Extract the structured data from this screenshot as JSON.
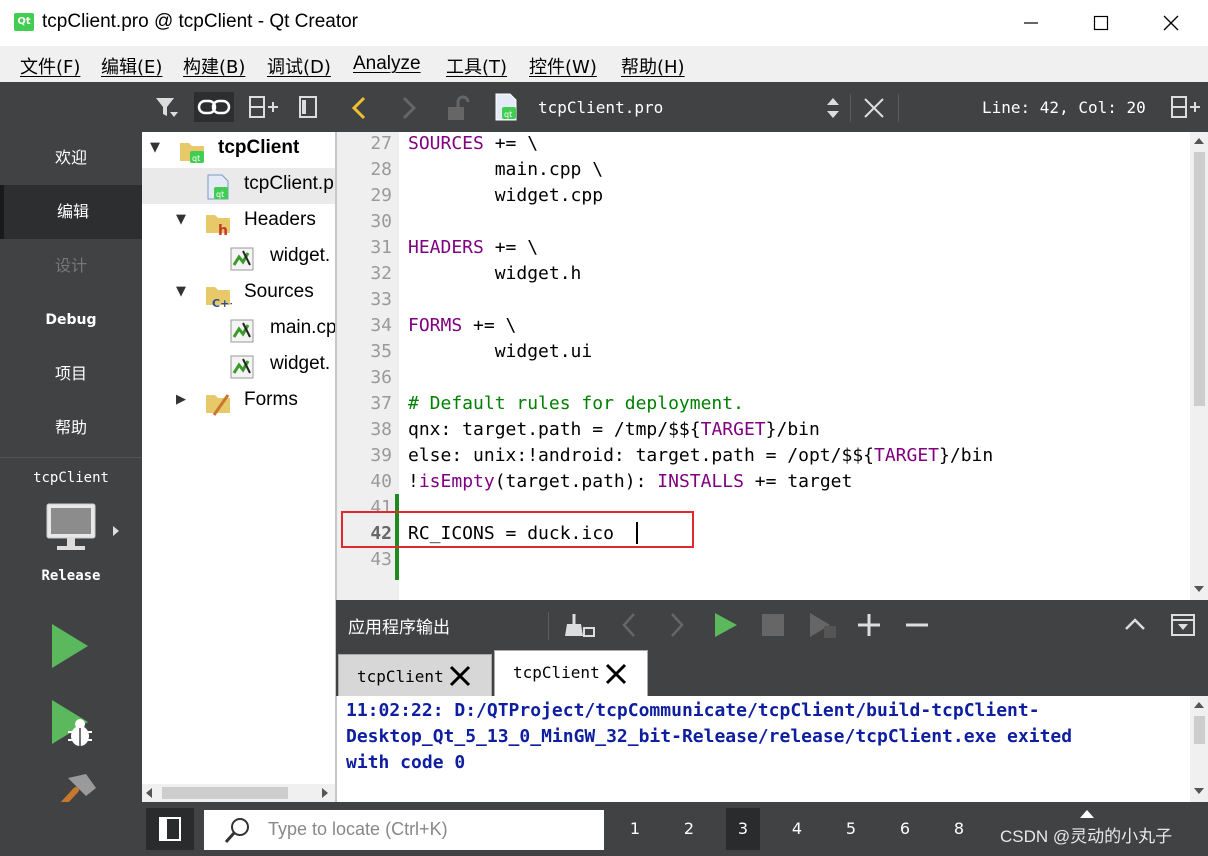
{
  "window": {
    "app_logo": "Qt",
    "title": "tcpClient.pro @ tcpClient - Qt Creator"
  },
  "menu": [
    "文件(F)",
    "编辑(E)",
    "构建(B)",
    "调试(D)",
    "Analyze",
    "工具(T)",
    "控件(W)",
    "帮助(H)"
  ],
  "modes": [
    "欢迎",
    "编辑",
    "设计",
    "Debug",
    "项目",
    "帮助"
  ],
  "target": {
    "project": "tcpClient",
    "config": "Release"
  },
  "tree": {
    "root": "tcpClient",
    "pro_file": "tcpClient.p",
    "headers": "Headers",
    "header_file": "widget.",
    "sources": "Sources",
    "source_main": "main.cp",
    "source_widget": "widget.",
    "forms": "Forms"
  },
  "editor": {
    "file_icon": "qt",
    "file_name": "tcpClient.pro",
    "cursor": "Line: 42, Col: 20",
    "lines": [
      {
        "n": "27",
        "segs": [
          {
            "t": "SOURCES",
            "c": "kw"
          },
          {
            "t": " += \\",
            "c": ""
          }
        ]
      },
      {
        "n": "28",
        "segs": [
          {
            "t": "        main.cpp \\",
            "c": ""
          }
        ]
      },
      {
        "n": "29",
        "segs": [
          {
            "t": "        widget.cpp",
            "c": ""
          }
        ]
      },
      {
        "n": "30",
        "segs": []
      },
      {
        "n": "31",
        "segs": [
          {
            "t": "HEADERS",
            "c": "kw"
          },
          {
            "t": " += \\",
            "c": ""
          }
        ]
      },
      {
        "n": "32",
        "segs": [
          {
            "t": "        widget.h",
            "c": ""
          }
        ]
      },
      {
        "n": "33",
        "segs": []
      },
      {
        "n": "34",
        "segs": [
          {
            "t": "FORMS",
            "c": "kw"
          },
          {
            "t": " += \\",
            "c": ""
          }
        ]
      },
      {
        "n": "35",
        "segs": [
          {
            "t": "        widget.ui",
            "c": ""
          }
        ]
      },
      {
        "n": "36",
        "segs": []
      },
      {
        "n": "37",
        "segs": [
          {
            "t": "# Default rules for deployment.",
            "c": "cm"
          }
        ]
      },
      {
        "n": "38",
        "segs": [
          {
            "t": "qnx: target.path = /tmp/$${",
            "c": ""
          },
          {
            "t": "TARGET",
            "c": "kw"
          },
          {
            "t": "}/bin",
            "c": ""
          }
        ]
      },
      {
        "n": "39",
        "segs": [
          {
            "t": "else: unix:!android: target.path = /opt/$${",
            "c": ""
          },
          {
            "t": "TARGET",
            "c": "kw"
          },
          {
            "t": "}/bin",
            "c": ""
          }
        ]
      },
      {
        "n": "40",
        "segs": [
          {
            "t": "!",
            "c": ""
          },
          {
            "t": "isEmpty",
            "c": "kw"
          },
          {
            "t": "(target.path): ",
            "c": ""
          },
          {
            "t": "INSTALLS",
            "c": "kw"
          },
          {
            "t": " += target",
            "c": ""
          }
        ]
      },
      {
        "n": "41",
        "segs": []
      },
      {
        "n": "42",
        "segs": [
          {
            "t": "RC_ICONS = duck.ico",
            "c": ""
          }
        ]
      },
      {
        "n": "43",
        "segs": []
      }
    ]
  },
  "output": {
    "title": "应用程序输出",
    "tabs": [
      "tcpClient",
      "tcpClient"
    ],
    "lines": [
      "11:02:22: D:/QTProject/tcpCommunicate/tcpClient/build-tcpClient-",
      "Desktop_Qt_5_13_0_MinGW_32_bit-Release/release/tcpClient.exe exited",
      "with code 0"
    ]
  },
  "status": {
    "locate_placeholder": "Type to locate (Ctrl+K)",
    "panes": [
      "1",
      "2",
      "3",
      "4",
      "5",
      "6",
      "8"
    ]
  },
  "watermark": "CSDN @灵动的小丸子",
  "colors": {
    "accent_green": "#5cb85c",
    "highlight_red": "#e0282e",
    "keyword": "#800080",
    "comment": "#008000",
    "output_text": "#0e1ea0"
  }
}
